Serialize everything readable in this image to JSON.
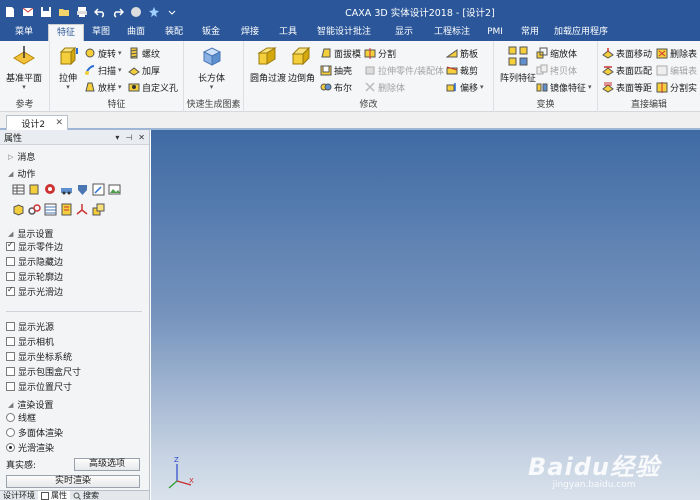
{
  "window": {
    "title": "CAXA 3D 实体设计2018 - [设计2]"
  },
  "quick_access": {
    "icons": [
      "new-file-icon",
      "mail-icon",
      "save-icon",
      "open-folder-icon",
      "print-icon",
      "undo-icon",
      "redo-icon",
      "sphere-icon",
      "star-icon",
      "chevron-down-icon"
    ]
  },
  "tabs": [
    {
      "label": "菜单"
    },
    {
      "label": "特征"
    },
    {
      "label": "草图"
    },
    {
      "label": "曲面"
    },
    {
      "label": "装配"
    },
    {
      "label": "钣金"
    },
    {
      "label": "焊接"
    },
    {
      "label": "工具"
    },
    {
      "label": "智能设计批注"
    },
    {
      "label": "显示"
    },
    {
      "label": "工程标注"
    },
    {
      "label": "PMI"
    },
    {
      "label": "常用"
    },
    {
      "label": "加载应用程序"
    }
  ],
  "active_tab": "特征",
  "ribbon": {
    "groups": {
      "ref": "参考",
      "feature": "特征",
      "quick": "快速生成图素",
      "modify": "修改",
      "transform": "变换",
      "direct": "直接编辑"
    },
    "base_plane": "基准平面",
    "extrude": "拉伸",
    "rotate": "旋转",
    "sweep": "扫描",
    "loft": "放样",
    "thread": "螺纹",
    "thicken": "加厚",
    "custom_hole": "自定义孔",
    "cuboid": "长方体",
    "fillet": "圆角过渡",
    "chamfer": "边倒角",
    "draft": "面拔模",
    "shell": "抽壳",
    "boolean": "布尔",
    "split": "分割",
    "stretch_part": "拉伸零件/装配体",
    "delete_body": "删除体",
    "rib": "筋板",
    "cut": "裁剪",
    "offset": "偏移",
    "array": "阵列特征",
    "scale": "缩放体",
    "copy_body": "拷贝体",
    "mirror": "镜像特征",
    "face_move": "表面移动",
    "face_match": "表面匹配",
    "face_equal": "表面等距",
    "delete_face": "删除表",
    "edit_face": "编辑表",
    "split_face": "分割实"
  },
  "document_tab": {
    "label": "设计2"
  },
  "panel": {
    "title": "属性",
    "sections": {
      "message": "消息",
      "action": "动作",
      "display": "显示设置",
      "render": "渲染设置"
    },
    "display_options": [
      {
        "label": "显示零件边",
        "checked": true
      },
      {
        "label": "显示隐藏边",
        "checked": false
      },
      {
        "label": "显示轮廓边",
        "checked": false
      },
      {
        "label": "显示光滑边",
        "checked": true
      }
    ],
    "other_options": [
      {
        "label": "显示光源",
        "checked": false
      },
      {
        "label": "显示相机",
        "checked": false
      },
      {
        "label": "显示坐标系统",
        "checked": false
      },
      {
        "label": "显示包围盒尺寸",
        "checked": false
      },
      {
        "label": "显示位置尺寸",
        "checked": false
      }
    ],
    "render_options": [
      {
        "label": "线框",
        "selected": false
      },
      {
        "label": "多面体渲染",
        "selected": false
      },
      {
        "label": "光滑渲染",
        "selected": true
      }
    ],
    "realism_label": "真实感:",
    "advanced_button": "高级选项",
    "realtime_button": "实时渲染",
    "bottom_tabs": [
      {
        "label": "设计环境"
      },
      {
        "label": "属性"
      },
      {
        "label": "搜索"
      }
    ]
  },
  "viewport": {
    "axis_labels": {
      "z": "Z",
      "x": "X"
    },
    "watermark": {
      "main": "Baidu经验",
      "sub": "jingyan.baidu.com"
    }
  },
  "colors": {
    "titlebar": "#2b579a",
    "ribbon": "#f5f6f7",
    "viewport_top": "#3e6aa4",
    "viewport_bottom": "#d9e2ec"
  }
}
